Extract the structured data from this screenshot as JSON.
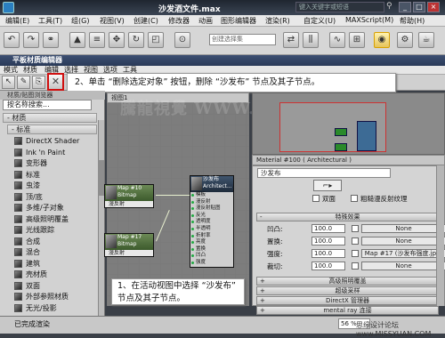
{
  "max": {
    "title": "沙发酒文件.max",
    "help_search_placeholder": "键入关键字或短语",
    "menu": [
      "编辑(E)",
      "工具(T)",
      "组(G)",
      "视图(V)",
      "创建(C)",
      "修改器",
      "动画",
      "图形编辑器",
      "渲染(R)",
      "自定义(U)",
      "MAXScript(M)",
      "帮助(H)"
    ],
    "selection_set_placeholder": "创建选择集"
  },
  "sme": {
    "title": "平板材质编辑器",
    "menu": [
      "模式",
      "材质",
      "编辑",
      "选择",
      "视图",
      "选项",
      "工具"
    ],
    "callout_2": "2、单击 “删除选定对象” 按钮，删除 “沙发布” 节点及其子节点。",
    "callout_1": "1、在活动视图中选择 “沙发布” 节点及其子节点。",
    "browser_title": "材质/贴图浏览器",
    "search_text": "按名称搜索...",
    "category_materials": "- 材质",
    "category_standard": "- 标准",
    "materials": [
      "DirectX Shader",
      "Ink 'n Paint",
      "变形器",
      "标准",
      "虫漆",
      "顶/底",
      "多维/子对象",
      "高级照明覆盖",
      "光线跟踪",
      "合成",
      "混合",
      "建筑",
      "壳材质",
      "双面",
      "外部参照材质",
      "无光/投影"
    ],
    "view_tab": "视图1",
    "nodes": {
      "map_a_title": "Map #10",
      "map_a_type": "Bitmap",
      "map_a_sub": "漫反射",
      "map_b_title": "Map #17",
      "map_b_type": "Bitmap",
      "map_b_sub": "漫反射",
      "mat_title": "沙发布",
      "mat_type": "Architect...",
      "mat_slots": [
        "模板",
        "漫反射",
        "漫反射贴图",
        "反光",
        "透明度",
        "半透明",
        "折射率",
        "亮度",
        "置换",
        "凹凸",
        "强度"
      ]
    },
    "param_title": "Material #100 ( Architectural )",
    "param_name": "沙发布",
    "two_sided_label": "双面",
    "rough_label": "粗糙漫反射纹理",
    "special_effects": "特殊效果",
    "params": [
      {
        "label": "凹凸:",
        "value": "100.0",
        "map": "None"
      },
      {
        "label": "置换:",
        "value": "100.0",
        "map": "None"
      },
      {
        "label": "强度:",
        "value": "100.0",
        "map": "Map #17 (沙发布强度.jpg)"
      },
      {
        "label": "裁切:",
        "value": "100.0",
        "map": "None"
      }
    ],
    "rollouts": [
      "高级照明覆盖",
      "超级采样",
      "DirectX 管理器",
      "mental ray 连接"
    ],
    "status": "已完成渲染",
    "zoom": "56 %"
  },
  "watermarks": {
    "top": "騰龍視覺 WWW.TWT.NET",
    "bottom": "思缘设计论坛 www.MISSYUAN.COM"
  }
}
